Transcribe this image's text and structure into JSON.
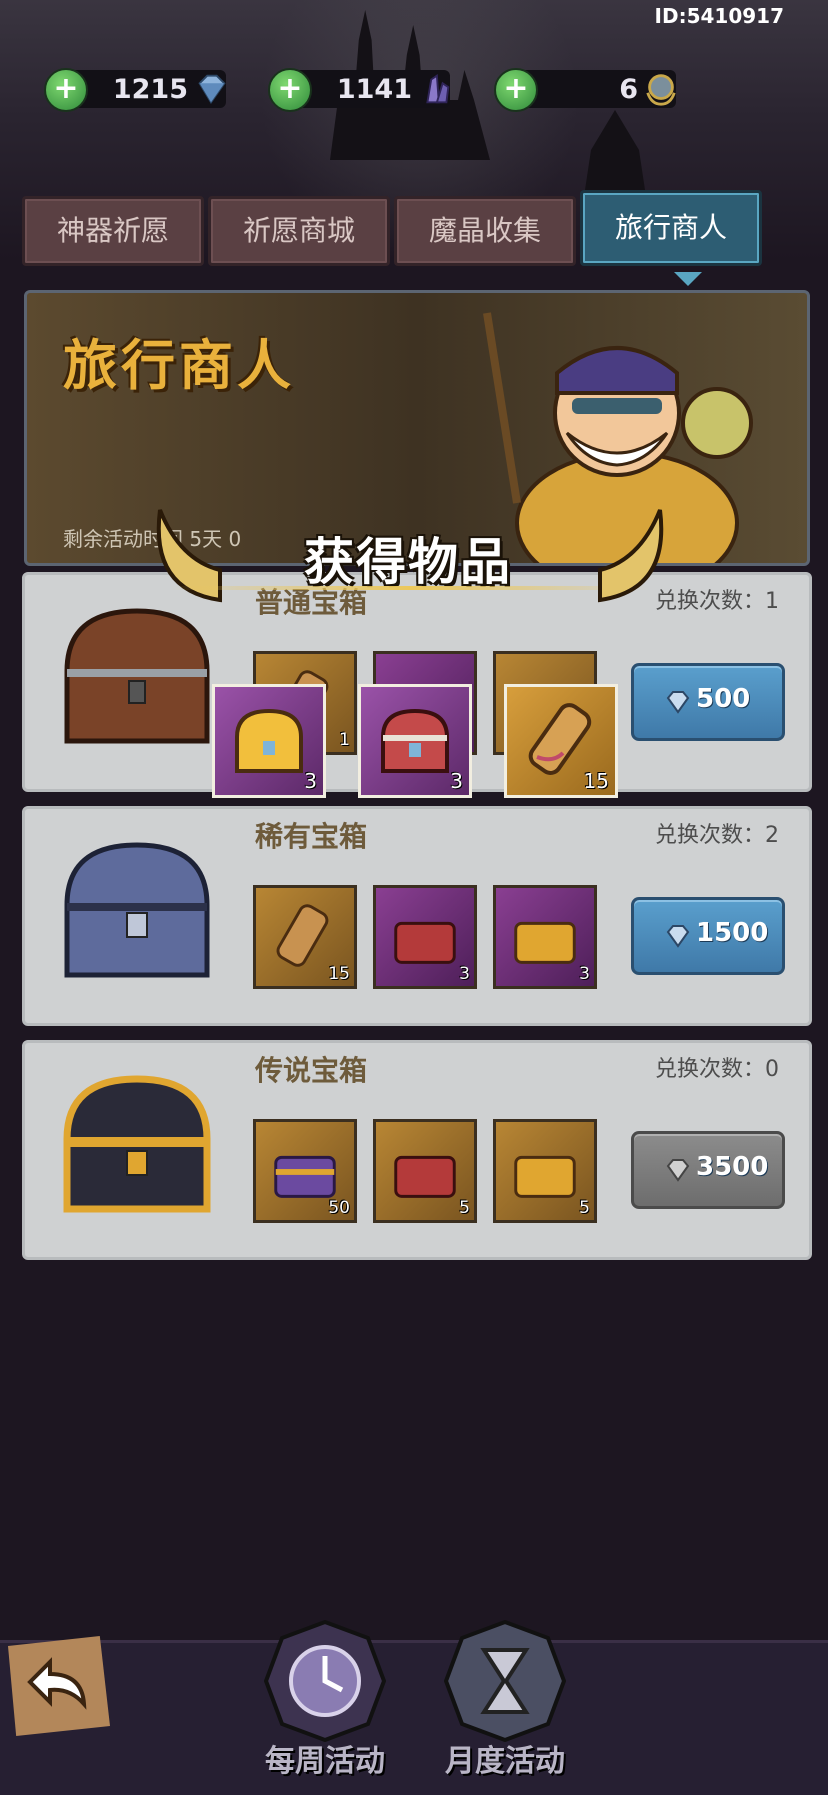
{
  "header": {
    "id_label": "ID:5410917",
    "resources": [
      {
        "value": "1215",
        "icon": "diamond-icon"
      },
      {
        "value": "1141",
        "icon": "crystal-icon"
      },
      {
        "value": "6",
        "icon": "medal-icon"
      }
    ]
  },
  "tabs": [
    {
      "label": "神器祈愿",
      "active": false
    },
    {
      "label": "祈愿商城",
      "active": false
    },
    {
      "label": "魔晶收集",
      "active": false
    },
    {
      "label": "旅行商人",
      "active": true
    }
  ],
  "banner": {
    "title": "旅行商人",
    "remaining_text": "剩余活动时间 5天 0"
  },
  "popup": {
    "title": "获得物品",
    "items": [
      {
        "icon": "gold-chest-icon",
        "qty": "3"
      },
      {
        "icon": "red-chest-icon",
        "qty": "3"
      },
      {
        "icon": "scroll-icon",
        "qty": "15"
      }
    ]
  },
  "chests": [
    {
      "name": "普通宝箱",
      "exchange_count": "兑换次数：1",
      "price": "500",
      "button_enabled": true,
      "items": [
        {
          "icon": "scroll-icon",
          "qty": "1"
        },
        {
          "icon": "red-chest-icon",
          "qty": ""
        },
        {
          "icon": "gold-chest-icon",
          "qty": ""
        }
      ]
    },
    {
      "name": "稀有宝箱",
      "exchange_count": "兑换次数：2",
      "price": "1500",
      "button_enabled": true,
      "items": [
        {
          "icon": "scroll-icon",
          "qty": "15"
        },
        {
          "icon": "red-chest-icon",
          "qty": "3"
        },
        {
          "icon": "gold-chest-icon",
          "qty": "3"
        }
      ]
    },
    {
      "name": "传说宝箱",
      "exchange_count": "兑换次数：0",
      "price": "3500",
      "button_enabled": false,
      "items": [
        {
          "icon": "purple-chest-icon",
          "qty": "50"
        },
        {
          "icon": "red-chest-icon",
          "qty": "5"
        },
        {
          "icon": "gold-chest-icon",
          "qty": "5"
        }
      ]
    }
  ],
  "bottom_nav": {
    "weekly": "每周活动",
    "monthly": "月度活动"
  },
  "colors": {
    "accent_blue": "#3f79a8",
    "title_gold": "#e9b13c",
    "tab_inactive": "#5a4043",
    "tab_active": "#2d5d73"
  }
}
